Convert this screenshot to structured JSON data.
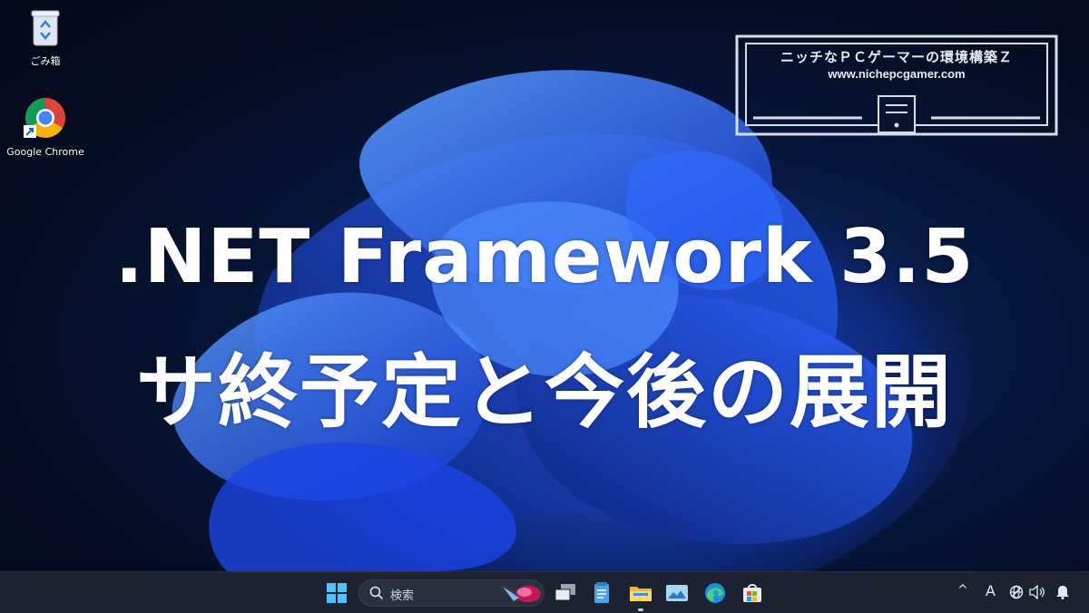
{
  "desktop": {
    "icons": [
      {
        "label": "ごみ箱",
        "icon": "recycle-bin-icon"
      },
      {
        "label": "Google Chrome",
        "icon": "chrome-icon"
      }
    ]
  },
  "logo": {
    "line1": "ニッチなＰＣゲーマーの環境構築Ｚ",
    "line2": "www.nichepcgamer.com"
  },
  "headline": {
    "line1": ".NET Framework 3.5",
    "line2": "サ終予定と今後の展開"
  },
  "taskbar": {
    "search_placeholder": "検索",
    "pinned": [
      "start-icon",
      "search-icon",
      "task-view-icon",
      "notepad-icon",
      "file-explorer-icon",
      "photos-icon",
      "edge-icon",
      "store-icon"
    ],
    "tray": {
      "chevron": "^",
      "ime": "A"
    }
  },
  "colors": {
    "taskbar_bg": "#1d2230",
    "bloom_blue": "#1a4bff",
    "headline": "#ffffff"
  }
}
